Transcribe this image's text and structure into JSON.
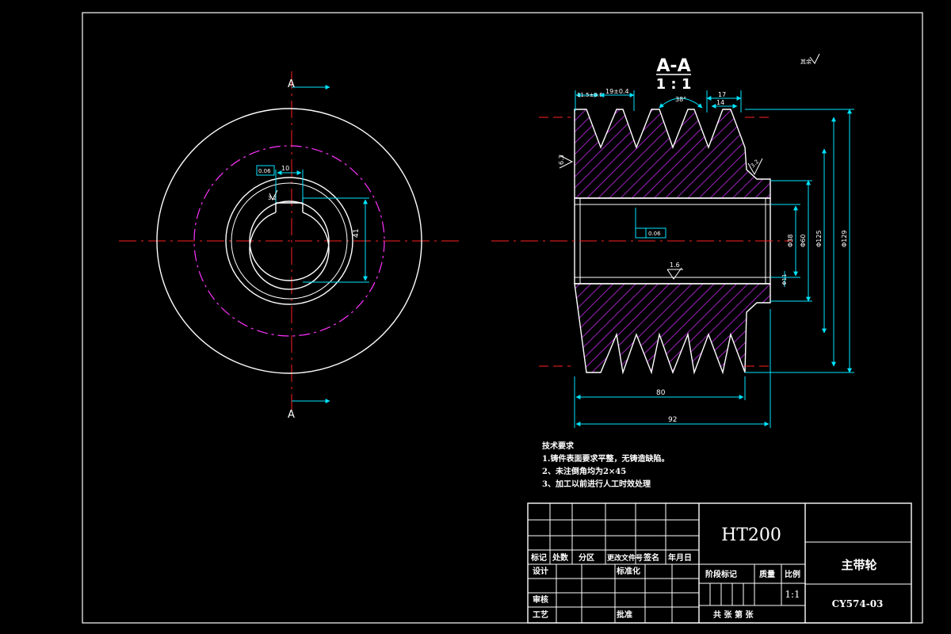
{
  "section": {
    "label": "A-A",
    "scale": "1 : 1"
  },
  "view_marks": {
    "top": "A",
    "bottom": "A"
  },
  "corner_mark": "其余",
  "colors": {
    "outline": "#ffffff",
    "center": "#ff2020",
    "dim": "#00e5ff",
    "pitch": "#ff33ff",
    "hatch": "#a020c0",
    "text": "#ffffff"
  },
  "front_view": {
    "keyway_width": "10",
    "keyway_depth": "41",
    "roughness": "3.2",
    "tolerance_box": "0.06"
  },
  "section_view": {
    "dims": {
      "d1": "11.5±0.6",
      "d2": "19±0.4",
      "angle": "38°",
      "d3": "17",
      "d4": "14",
      "r1": "6.3",
      "r2": "3.2",
      "r3": "1.6",
      "gtol": "0.06",
      "len80": "80",
      "len92": "92",
      "dia38": "Φ38",
      "dia60": "Φ60",
      "dia125": "Φ125",
      "dia129": "Φ129",
      "dia11": "Φ11"
    }
  },
  "tech": {
    "title": "技术要求",
    "items": [
      "1.铸件表面要求平整，无铸造缺陷。",
      "2、未注倒角均为2×45",
      "3、加工以前进行人工时效处理"
    ]
  },
  "title_block": {
    "material": "HT200",
    "part_name": "主带轮",
    "drawing_no": "CY574-03",
    "scale_value": "1:1",
    "hdr": [
      "标记",
      "处数",
      "分区",
      "更改文件号",
      "签名",
      "年月日"
    ],
    "design": "设计",
    "standard": "标准化",
    "stage_mark": "阶段标记",
    "weight": "质量",
    "ratio": "比例",
    "check": "审核",
    "process": "工艺",
    "approve": "批准",
    "sheets": "共 张 第 张"
  }
}
